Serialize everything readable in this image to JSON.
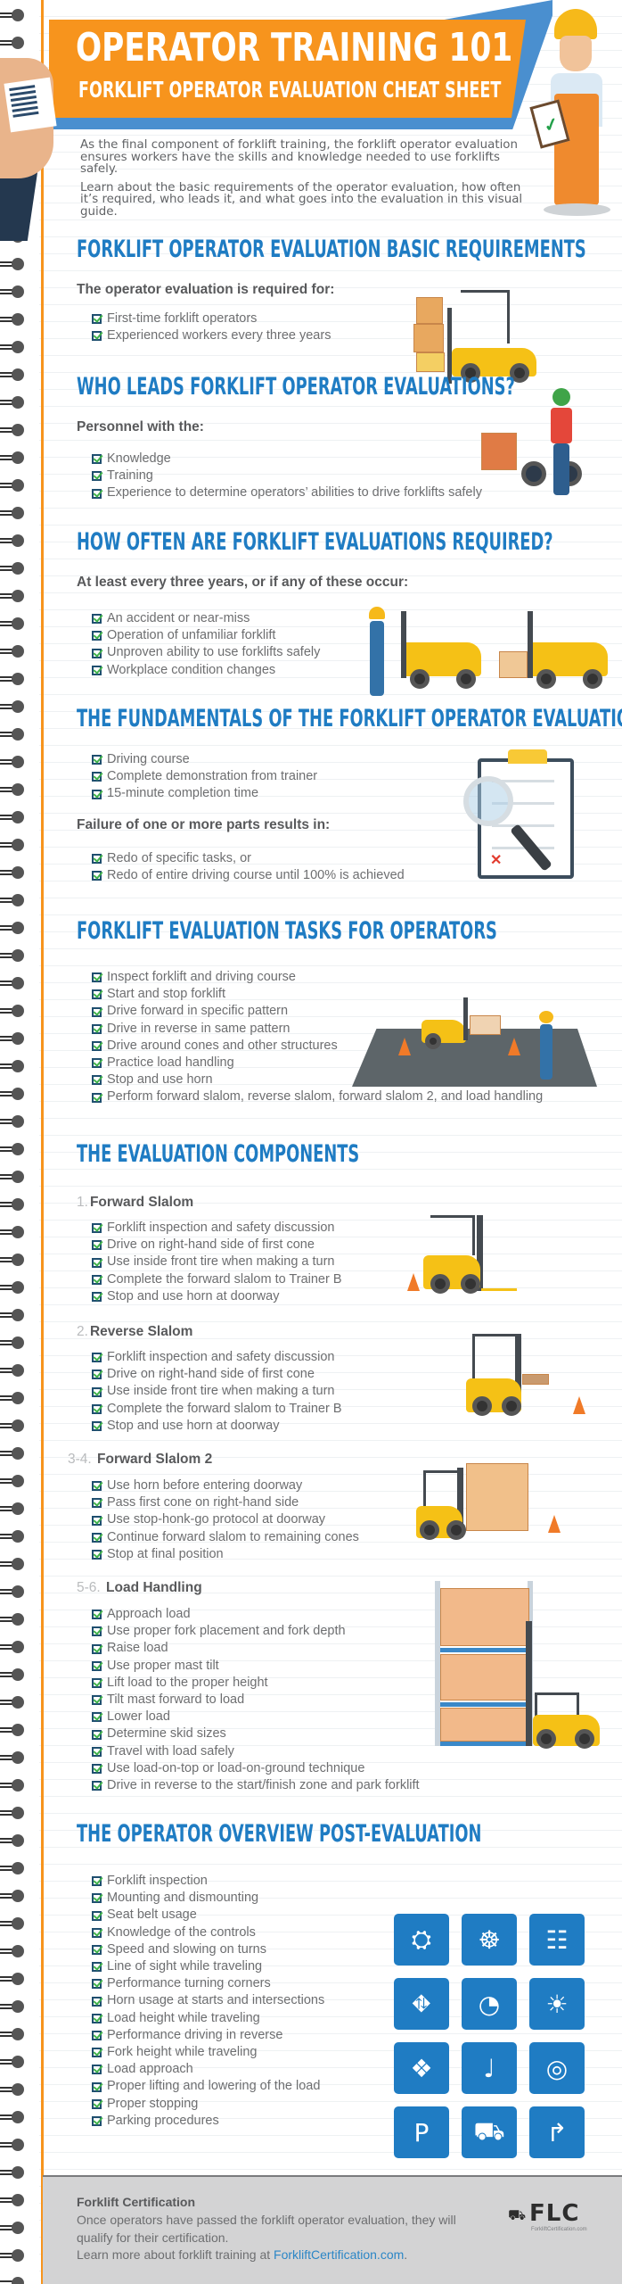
{
  "header": {
    "title": "OPERATOR TRAINING 101",
    "subtitle": "FORKLIFT OPERATOR EVALUATION CHEAT SHEET",
    "intro": [
      "As the final component of forklift training, the forklift operator evaluation ensures workers have the skills and knowledge needed to use forklifts safely.",
      "Learn about the basic requirements of the operator evaluation, how often it’s required, who leads it, and what goes into the evaluation in this visual guide."
    ]
  },
  "colors": {
    "accent_orange": "#f7941d",
    "heading_blue": "#1f7cc3",
    "header_blue": "#4a8fcf",
    "check_green": "#3fb14a",
    "footer_gray": "#d3d3d4"
  },
  "sections": {
    "basic_requirements": {
      "heading": "FORKLIFT OPERATOR EVALUATION BASIC REQUIREMENTS",
      "lead": "The operator evaluation is required for:",
      "items": [
        "First-time forklift operators",
        "Experienced workers every three years"
      ]
    },
    "who_leads": {
      "heading": "WHO LEADS FORKLIFT OPERATOR EVALUATIONS?",
      "lead": "Personnel with the:",
      "items": [
        "Knowledge",
        "Training",
        "Experience to determine operators’ abilities to drive forklifts safely"
      ]
    },
    "how_often": {
      "heading": "HOW OFTEN ARE FORKLIFT EVALUATIONS REQUIRED?",
      "lead": "At least every three years, or if any of these occur:",
      "items": [
        "An accident or near-miss",
        "Operation of unfamiliar forklift",
        "Unproven ability to use forklifts safely",
        "Workplace condition changes"
      ]
    },
    "fundamentals": {
      "heading": "THE FUNDAMENTALS OF THE FORKLIFT OPERATOR EVALUATION",
      "items": [
        "Driving course",
        "Complete demonstration from trainer",
        "15-minute completion time"
      ],
      "lead": "Failure of one or more parts results in:",
      "failure_items": [
        "Redo of specific tasks, or",
        "Redo of entire driving course until 100% is achieved"
      ]
    },
    "tasks": {
      "heading": "FORKLIFT EVALUATION TASKS FOR OPERATORS",
      "items": [
        "Inspect forklift and driving course",
        "Start and stop forklift",
        "Drive forward in specific pattern",
        "Drive in reverse in same pattern",
        "Drive around cones and other structures",
        "Practice load handling",
        "Stop and use horn",
        "Perform forward slalom, reverse slalom, forward slalom 2, and load handling"
      ]
    },
    "components": {
      "heading": "THE EVALUATION COMPONENTS",
      "groups": [
        {
          "num": "1.",
          "title": "Forward Slalom",
          "items": [
            "Forklift inspection and safety discussion",
            "Drive on right-hand side of first cone",
            "Use inside front tire when making a turn",
            "Complete the forward slalom to Trainer B",
            "Stop and use horn at doorway"
          ]
        },
        {
          "num": "2.",
          "title": "Reverse Slalom",
          "items": [
            "Forklift inspection and safety discussion",
            "Drive on right-hand side of first cone",
            "Use inside front tire when making a turn",
            "Complete the forward slalom to Trainer B",
            "Stop and use horn at doorway"
          ]
        },
        {
          "num": "3-4.",
          "title": "Forward Slalom 2",
          "items": [
            "Use horn before entering doorway",
            "Pass first cone on right-hand side",
            "Use stop-honk-go protocol at doorway",
            "Continue forward slalom to remaining cones",
            "Stop at final position"
          ]
        },
        {
          "num": "5-6.",
          "title": "Load Handling",
          "items": [
            "Approach load",
            "Use proper fork placement and fork depth",
            "Raise load",
            "Use proper mast tilt",
            "Lift load to the proper height",
            "Tilt mast forward to load",
            "Lower load",
            "Determine skid sizes",
            "Travel with load safely",
            "Use load-on-top or load-on-ground technique",
            "Drive in reverse to the start/finish zone and park forklift"
          ]
        }
      ]
    },
    "overview": {
      "heading": "THE OPERATOR OVERVIEW POST-EVALUATION",
      "items": [
        "Forklift inspection",
        "Mounting and dismounting",
        "Seat belt usage",
        "Knowledge of the controls",
        "Speed and slowing on turns",
        "Line of sight while traveling",
        "Performance turning corners",
        "Horn usage at starts and intersections",
        "Load height while traveling",
        "Performance driving in reverse",
        "Fork height while traveling",
        "Load approach",
        "Proper lifting and lowering of the load",
        "Proper stopping",
        "Parking procedures"
      ],
      "icons": [
        {
          "name": "seat-belt-icon",
          "glyph": "⛭"
        },
        {
          "name": "steering-wheel-icon",
          "glyph": "☸"
        },
        {
          "name": "gear-shift-pattern-icon",
          "glyph": "☷"
        },
        {
          "name": "road-icon",
          "glyph": "⛖"
        },
        {
          "name": "speedometer-icon",
          "glyph": "◔"
        },
        {
          "name": "headlight-icon",
          "glyph": "☀"
        },
        {
          "name": "layers-icon",
          "glyph": "❖"
        },
        {
          "name": "joystick-lever-icon",
          "glyph": "♩"
        },
        {
          "name": "brake-disc-icon",
          "glyph": "◎"
        },
        {
          "name": "parking-sign-icon",
          "glyph": "P"
        },
        {
          "name": "forklift-icon",
          "glyph": "⛟"
        },
        {
          "name": "turn-arrow-icon",
          "glyph": "↱"
        }
      ]
    }
  },
  "footer": {
    "title": "Forklift Certification",
    "text": "Once operators have passed the forklift operator evaluation, they will qualify for their certification.",
    "learn_more_prefix": "Learn more about forklift training at ",
    "link_text": "ForkliftCertification.com",
    "learn_more_suffix": ".",
    "logo_text": "FLC",
    "logo_sub": "ForkliftCertification.com"
  }
}
